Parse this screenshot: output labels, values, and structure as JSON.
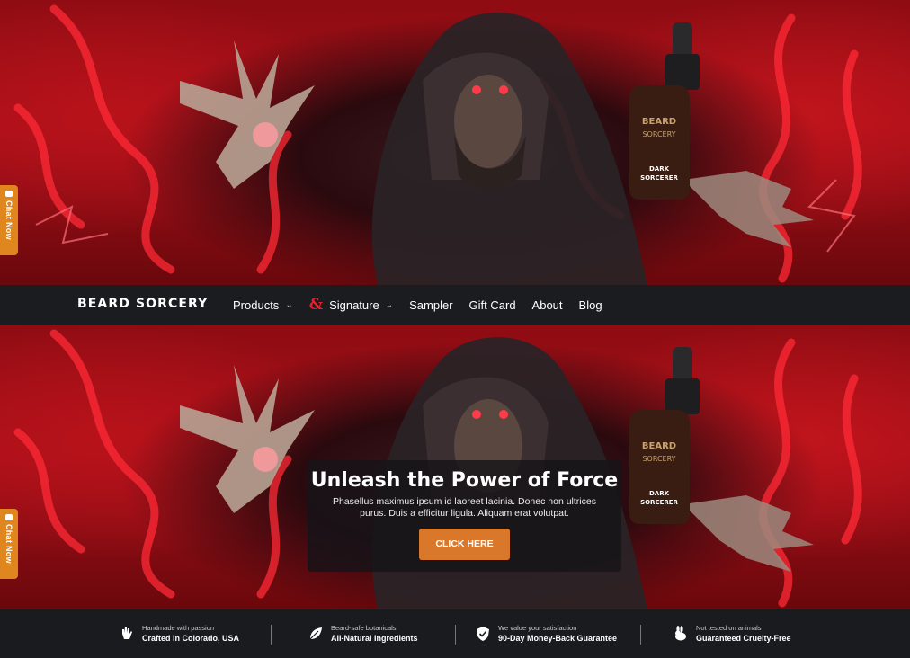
{
  "chat": {
    "label": "Chat Now"
  },
  "nav": {
    "logo": "BEARD SORCERY",
    "items": [
      {
        "label": "Products",
        "has_dropdown": true
      },
      {
        "label": "Signature",
        "has_dropdown": true,
        "icon": "ampersand-icon"
      },
      {
        "label": "Sampler"
      },
      {
        "label": "Gift Card"
      },
      {
        "label": "About"
      },
      {
        "label": "Blog"
      }
    ]
  },
  "hero": {
    "bottle_brand": "BEARD SORCERY",
    "bottle_name": "DARK SORCERER",
    "cta": {
      "title": "Unleash the Power of Force",
      "text": "Phasellus maximus ipsum id laoreet lacinia. Donec non ultrices purus. Duis a efficitur ligula. Aliquam erat volutpat.",
      "button": "CLICK HERE"
    }
  },
  "features": [
    {
      "icon": "hand-icon",
      "small": "Handmade with passion",
      "big": "Crafted in Colorado, USA"
    },
    {
      "icon": "leaf-icon",
      "small": "Beard-safe botanicals",
      "big": "All-Natural Ingredients"
    },
    {
      "icon": "shield-check-icon",
      "small": "We value your satisfaction",
      "big": "90-Day Money-Back Guarantee"
    },
    {
      "icon": "rabbit-icon",
      "small": "Not tested on animals",
      "big": "Guaranteed Cruelty-Free"
    }
  ],
  "colors": {
    "accent": "#d9772a",
    "chat_tab": "#e0861f",
    "nav_bg": "#1b1c20",
    "brand_red": "#e0232c"
  }
}
